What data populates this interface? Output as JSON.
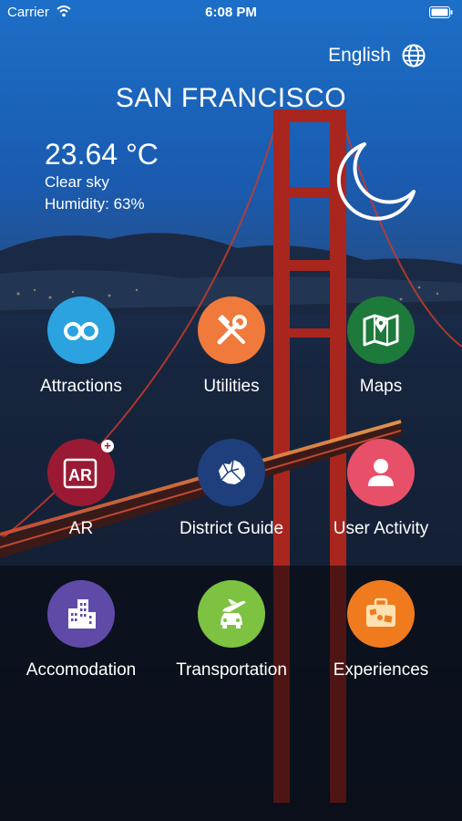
{
  "status_bar": {
    "carrier": "Carrier",
    "time": "6:08 PM"
  },
  "language": {
    "label": "English",
    "icon": "globe-icon"
  },
  "city": "SAN FRANCISCO",
  "weather": {
    "temperature": "23.64 °C",
    "description": "Clear sky",
    "humidity": "Humidity: 63%",
    "icon": "moon-icon"
  },
  "tiles": [
    {
      "label": "Attractions",
      "icon": "binoculars-icon",
      "color": "#2aa3e0"
    },
    {
      "label": "Utilities",
      "icon": "tools-icon",
      "color": "#f07a3b"
    },
    {
      "label": "Maps",
      "icon": "map-pin-icon",
      "color": "#1e7a3a"
    },
    {
      "label": "AR",
      "icon": "ar-icon",
      "color": "#9b1a33",
      "badge": "+"
    },
    {
      "label": "District Guide",
      "icon": "district-map-icon",
      "color": "#1f3f7c"
    },
    {
      "label": "User Activity",
      "icon": "user-icon",
      "color": "#e8506a"
    },
    {
      "label": "Accomodation",
      "icon": "buildings-icon",
      "color": "#5f4aa8"
    },
    {
      "label": "Transportation",
      "icon": "plane-car-icon",
      "color": "#7dc241"
    },
    {
      "label": "Experiences",
      "icon": "suitcase-icon",
      "color": "#f07a1e"
    }
  ]
}
